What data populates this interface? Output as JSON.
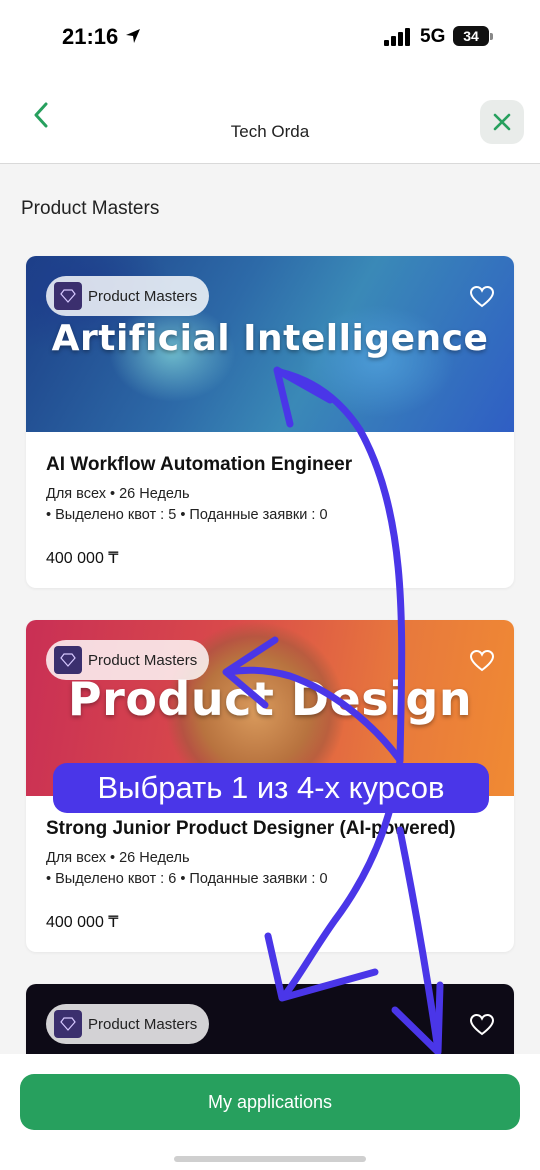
{
  "status_bar": {
    "time": "21:16",
    "network": "5G",
    "battery": "34"
  },
  "nav": {
    "title": "Tech Orda",
    "back_icon": "chevron-left-icon",
    "close_icon": "close-icon"
  },
  "section": {
    "title": "Product Masters"
  },
  "courses": [
    {
      "banner_title": "Artificial Intelligence",
      "provider": "Product Masters",
      "name": "AI Workflow Automation Engineer",
      "audience_duration": "Для всех • 26 Недель",
      "quota": "• Выделено квот : 5 • Поданные заявки : 0",
      "price": "400 000 ₸"
    },
    {
      "banner_title": "Product Design",
      "provider": "Product Masters",
      "name": "Strong Junior Product Designer (AI-powered)",
      "audience_duration": "Для всех • 26 Недель",
      "quota": "• Выделено квот : 6 • Поданные заявки : 0",
      "price": "400 000 ₸"
    },
    {
      "provider": "Product Masters"
    }
  ],
  "annotation": {
    "callout": "Выбрать 1 из 4-х курсов",
    "color": "#4a36e8"
  },
  "footer": {
    "button_label": "My applications"
  },
  "colors": {
    "accent": "#27a05e",
    "annotation": "#4a36e8"
  }
}
